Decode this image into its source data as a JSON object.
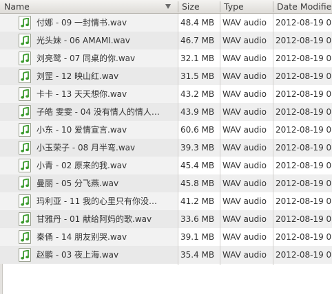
{
  "columns": {
    "name": "Name",
    "size": "Size",
    "type": "Type",
    "date": "Date Modifie"
  },
  "sort": {
    "column": "Name",
    "direction": "descending-indicator"
  },
  "icon": "audio-file-icon",
  "files": [
    {
      "name": "付娜 - 09 一封情书.wav",
      "size": "48.4 MB",
      "type": "WAV audio",
      "date": "2012-08-19 0"
    },
    {
      "name": "光头妹 - 06 AMAMI.wav",
      "size": "46.7 MB",
      "type": "WAV audio",
      "date": "2012-08-19 0"
    },
    {
      "name": "刘亮鹭 - 07 同桌的你.wav",
      "size": "32.1 MB",
      "type": "WAV audio",
      "date": "2012-08-19 0"
    },
    {
      "name": "刘罡 - 12 映山红.wav",
      "size": "31.5 MB",
      "type": "WAV audio",
      "date": "2012-08-19 0"
    },
    {
      "name": "卡卡 - 13 天天想你.wav",
      "size": "43.2 MB",
      "type": "WAV audio",
      "date": "2012-08-19 0"
    },
    {
      "name": "子皓 雯雯 - 04 没有情人的情人…",
      "size": "43.9 MB",
      "type": "WAV audio",
      "date": "2012-08-19 0"
    },
    {
      "name": "小东 - 10 爱情宣言.wav",
      "size": "60.6 MB",
      "type": "WAV audio",
      "date": "2012-08-19 0"
    },
    {
      "name": "小玉荣子 - 08 月半弯.wav",
      "size": "39.3 MB",
      "type": "WAV audio",
      "date": "2012-08-19 0"
    },
    {
      "name": "小青 - 02 原来的我.wav",
      "size": "45.4 MB",
      "type": "WAV audio",
      "date": "2012-08-19 0"
    },
    {
      "name": "曼丽 - 05 分飞燕.wav",
      "size": "45.8 MB",
      "type": "WAV audio",
      "date": "2012-08-19 0"
    },
    {
      "name": "玛利亚 - 11 我的心里只有你没…",
      "size": "41.2 MB",
      "type": "WAV audio",
      "date": "2012-08-19 0"
    },
    {
      "name": "甘雅丹 - 01 献给阿妈的歌.wav",
      "size": "33.6 MB",
      "type": "WAV audio",
      "date": "2012-08-19 0"
    },
    {
      "name": "秦俑 - 14 朋友别哭.wav",
      "size": "39.1 MB",
      "type": "WAV audio",
      "date": "2012-08-19 0"
    },
    {
      "name": "赵鹏 - 03 夜上海.wav",
      "size": "35.4 MB",
      "type": "WAV audio",
      "date": "2012-08-19 0"
    }
  ]
}
